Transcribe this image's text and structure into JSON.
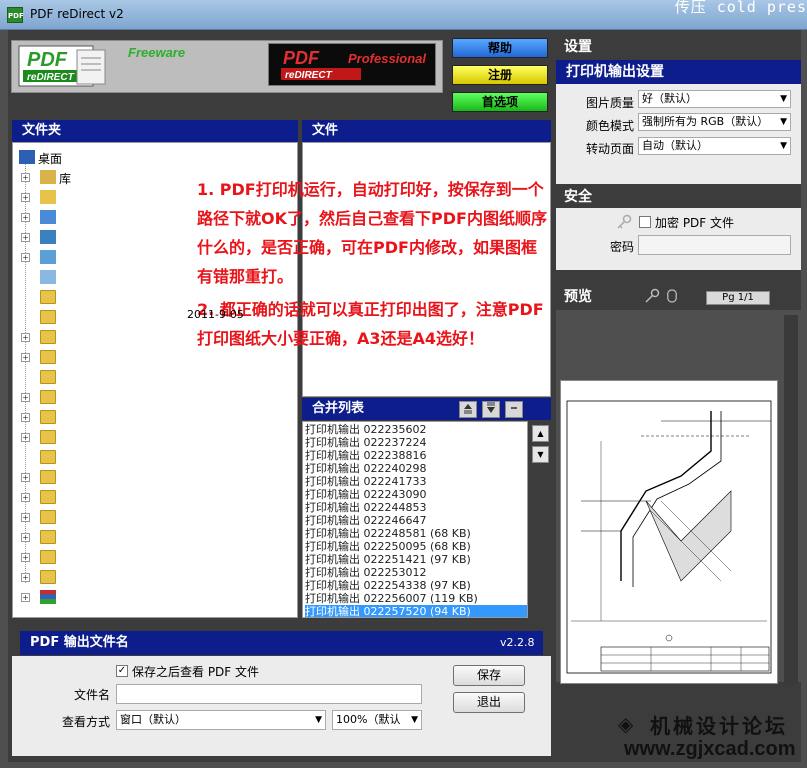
{
  "window": {
    "title": "PDF reDirect v2",
    "corner_text": "传压  cold pres"
  },
  "banner": {
    "freeware_label": "Freeware",
    "professional_label": "Professional",
    "logo_text": "PDF",
    "logo_sub": "reDIRECT"
  },
  "top_buttons": {
    "help": "帮助",
    "register": "注册",
    "prefs": "首选项"
  },
  "folders": {
    "title": "文件夹",
    "items": [
      {
        "label": "桌面",
        "expandable": false,
        "icon": "desktop-icon"
      },
      {
        "label": "库",
        "expandable": true,
        "icon": "library-icon"
      },
      {
        "label": "",
        "expandable": true,
        "icon": "user-folder-icon"
      },
      {
        "label": "",
        "expandable": true,
        "icon": "computer-icon"
      },
      {
        "label": "",
        "expandable": true,
        "icon": "network-icon"
      },
      {
        "label": "",
        "expandable": true,
        "icon": "control-panel-icon"
      },
      {
        "label": "",
        "expandable": false,
        "icon": "recycle-bin-icon"
      },
      {
        "label": "",
        "expandable": false,
        "icon": "folder-icon"
      },
      {
        "label": "",
        "expandable": false,
        "icon": "folder-icon"
      },
      {
        "label": "",
        "expandable": true,
        "icon": "folder-icon"
      },
      {
        "label": "",
        "expandable": true,
        "icon": "folder-icon"
      },
      {
        "label": "",
        "expandable": false,
        "icon": "folder-icon"
      },
      {
        "label": "",
        "expandable": true,
        "icon": "folder-icon"
      },
      {
        "label": "",
        "expandable": true,
        "icon": "folder-icon"
      },
      {
        "label": "",
        "expandable": true,
        "icon": "folder-icon"
      },
      {
        "label": "",
        "expandable": false,
        "icon": "folder-icon"
      },
      {
        "label": "",
        "expandable": true,
        "icon": "folder-icon"
      },
      {
        "label": "",
        "expandable": true,
        "icon": "folder-icon"
      },
      {
        "label": "",
        "expandable": true,
        "icon": "folder-icon"
      },
      {
        "label": "",
        "expandable": true,
        "icon": "folder-icon"
      },
      {
        "label": "",
        "expandable": true,
        "icon": "folder-icon"
      },
      {
        "label": "",
        "expandable": true,
        "icon": "folder-icon"
      },
      {
        "label": "",
        "expandable": true,
        "icon": "books-icon"
      }
    ]
  },
  "files": {
    "title": "文件"
  },
  "note": {
    "line1": "1. PDF打印机运行，自动打印好，按保存到一个路径下就OK了，然后自己查看下PDF内图纸顺序什么的，是否正确，可在PDF内修改，如果图框有错那重打。",
    "line2": "2. 都正确的话就可以真正打印出图了，注意PDF打印图纸大小要正确，A3还是A4选好！",
    "date_fragment": "2011-9-05"
  },
  "merge": {
    "title": "合并列表",
    "items": [
      "打印机输出 022235602",
      "打印机输出 022237224",
      "打印机输出 022238816",
      "打印机输出 022240298",
      "打印机输出 022241733",
      "打印机输出 022243090",
      "打印机输出 022244853",
      "打印机输出 022246647",
      "打印机输出 022248581 (68 KB)",
      "打印机输出 022250095 (68 KB)",
      "打印机输出 022251421 (97 KB)",
      "打印机输出 022253012",
      "打印机输出 022254338 (97 KB)",
      "打印机输出 022256007 (119 KB)",
      "打印机输出 022257520 (94 KB)"
    ],
    "selected_index": 14
  },
  "output": {
    "title": "PDF 输出文件名",
    "version": "v2.2.8",
    "view_after_save_label": "保存之后查看 PDF 文件",
    "view_after_save_checked": true,
    "filename_label": "文件名",
    "filename_value": "",
    "view_mode_label": "查看方式",
    "view_mode_value": "窗口（默认）",
    "zoom_value": "100%（默认",
    "save_button": "保存",
    "exit_button": "退出"
  },
  "settings": {
    "title": "设置",
    "printer_title": "打印机输出设置",
    "image_quality_label": "图片质量",
    "image_quality_value": "好（默认）",
    "color_mode_label": "颜色模式",
    "color_mode_value": "强制所有为 RGB（默认）",
    "rotate_label": "转动页面",
    "rotate_value": "自动（默认）"
  },
  "security": {
    "title": "安全",
    "encrypt_label": "加密 PDF 文件",
    "encrypt_checked": false,
    "password_label": "密码",
    "password_value": ""
  },
  "preview": {
    "title": "预览",
    "page_indicator": "Pg 1/1"
  },
  "watermark": {
    "cn": "机械设计论坛",
    "url": "www.zgjxcad.com"
  }
}
